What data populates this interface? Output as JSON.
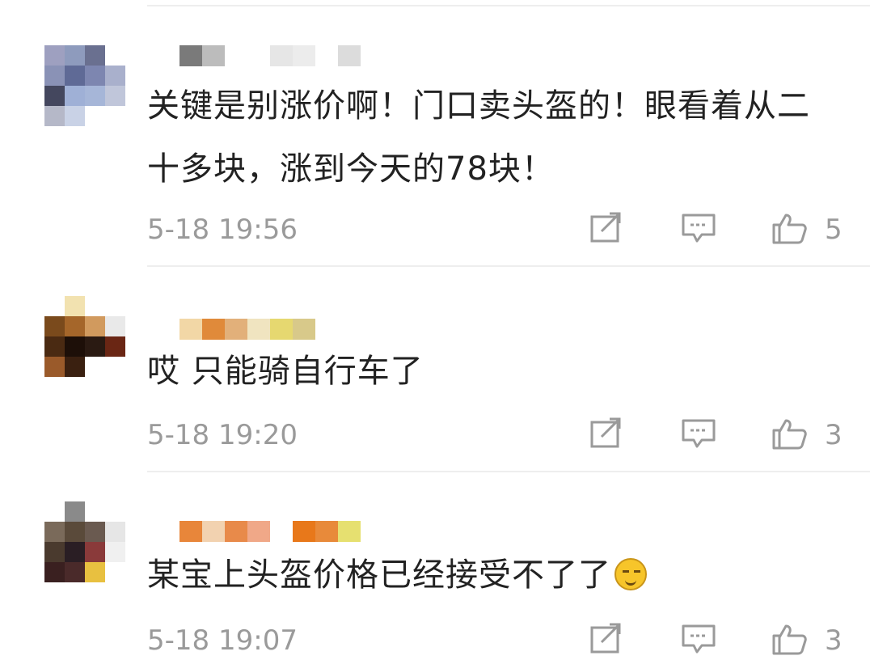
{
  "comments": [
    {
      "text": "关键是别涨价啊！门口卖头盔的！眼看着从二十多块，涨到今天的78块！",
      "timestamp": "5-18 19:56",
      "likes": "5",
      "username_hidden": true
    },
    {
      "text": "哎 只能骑自行车了",
      "timestamp": "5-18 19:20",
      "likes": "3",
      "username_hidden": true
    },
    {
      "text": "某宝上头盔价格已经接受不了了",
      "emoji": "awkward-smile-emoji",
      "timestamp": "5-18 19:07",
      "likes": "3",
      "username_hidden": true
    }
  ],
  "icons": {
    "share": "share-icon",
    "reply": "comment-icon",
    "like": "thumbs-up-icon"
  },
  "colors": {
    "text": "#222222",
    "meta": "#9a9a9a",
    "divider": "#eeeeee"
  }
}
